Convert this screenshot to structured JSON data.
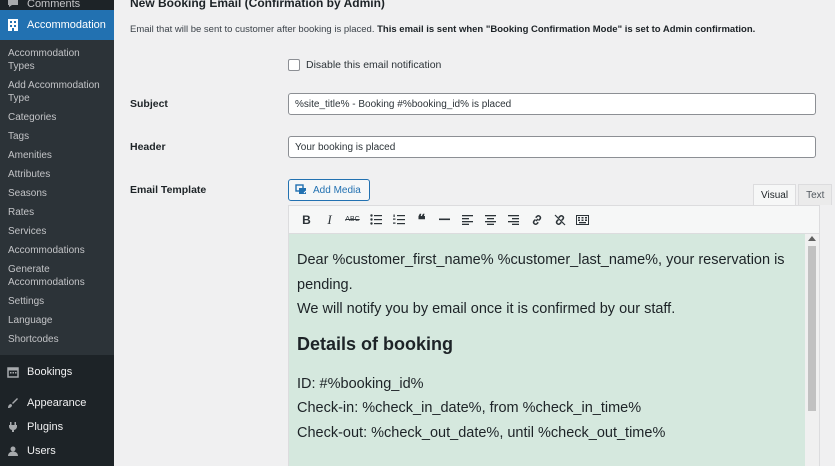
{
  "sidebar": {
    "comments": "Comments",
    "accommodation": "Accommodation",
    "sub_items": [
      "Accommodation Types",
      "Add Accommodation Type",
      "Categories",
      "Tags",
      "Amenities",
      "Attributes",
      "Seasons",
      "Rates",
      "Services",
      "Accommodations",
      "Generate Accommodations",
      "Settings",
      "Language",
      "Shortcodes"
    ],
    "bookings": "Bookings",
    "appearance": "Appearance",
    "plugins": "Plugins",
    "users": "Users"
  },
  "section": {
    "title": "New Booking Email (Confirmation by Admin)",
    "desc_plain": "Email that will be sent to customer after booking is placed. ",
    "desc_bold": "This email is sent when \"Booking Confirmation Mode\" is set to Admin confirmation."
  },
  "disable_label": "Disable this email notification",
  "subject": {
    "label": "Subject",
    "value": "%site_title% - Booking #%booking_id% is placed"
  },
  "header": {
    "label": "Header",
    "value": "Your booking is placed"
  },
  "template": {
    "label": "Email Template",
    "add_media": "Add Media",
    "tab_visual": "Visual",
    "tab_text": "Text",
    "content": {
      "line1": "Dear %customer_first_name% %customer_last_name%, your reservation is pending.",
      "line2": "We will notify you by email once it is confirmed by our staff.",
      "heading": "Details of booking",
      "id": "ID: #%booking_id%",
      "checkin": "Check-in: %check_in_date%, from %check_in_time%",
      "checkout": "Check-out: %check_out_date%, until %check_out_time%"
    }
  },
  "toolbar": {
    "bold": "B",
    "italic": "I",
    "strike": "ABC",
    "quote": "❝"
  },
  "colors": {
    "sidebar_bg": "#1d2327",
    "active_menu": "#2271b1",
    "editor_bg": "#d5e8de"
  }
}
